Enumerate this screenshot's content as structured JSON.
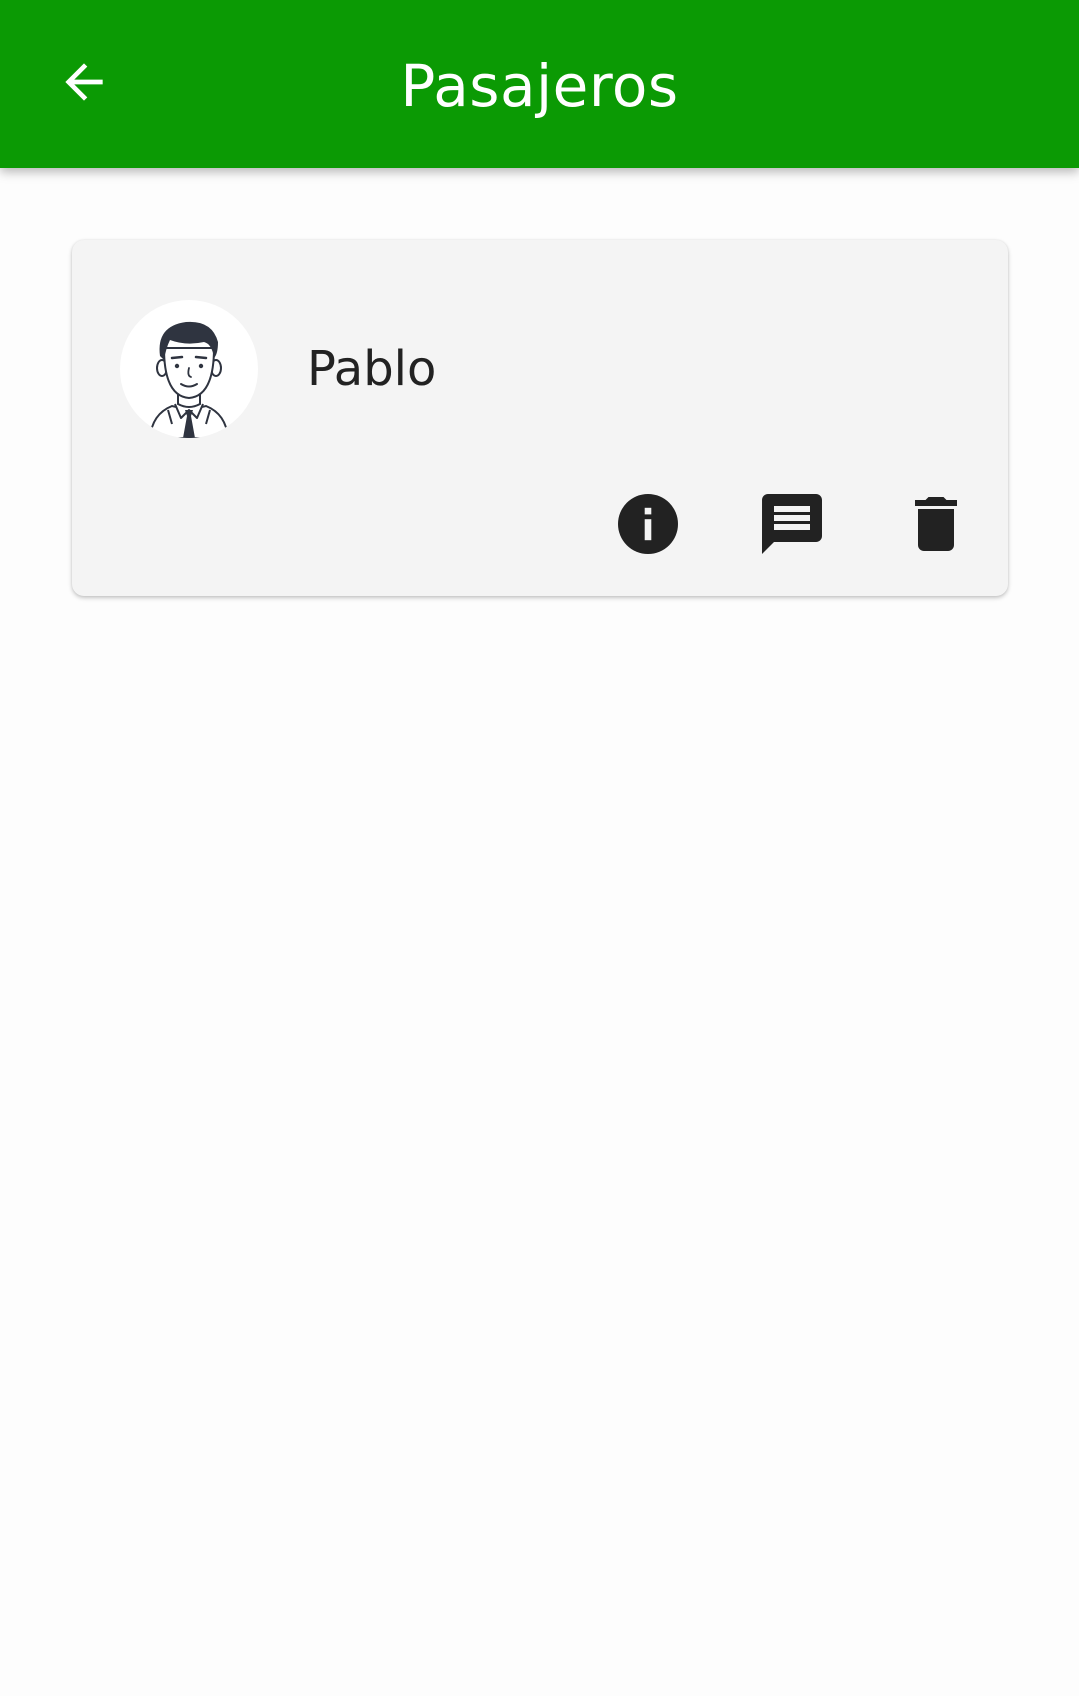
{
  "header": {
    "title": "Pasajeros",
    "back_icon": "arrow-left-icon",
    "background_color": "#0b9a04",
    "title_color": "#ffffff"
  },
  "passengers": [
    {
      "name": "Pablo",
      "avatar_icon": "man-avatar-icon",
      "actions": [
        {
          "icon": "info-icon"
        },
        {
          "icon": "message-icon"
        },
        {
          "icon": "trash-icon"
        }
      ]
    }
  ],
  "colors": {
    "card_background": "#f4f4f4",
    "icon_color": "#222222",
    "page_background": "#fdfdfd"
  }
}
